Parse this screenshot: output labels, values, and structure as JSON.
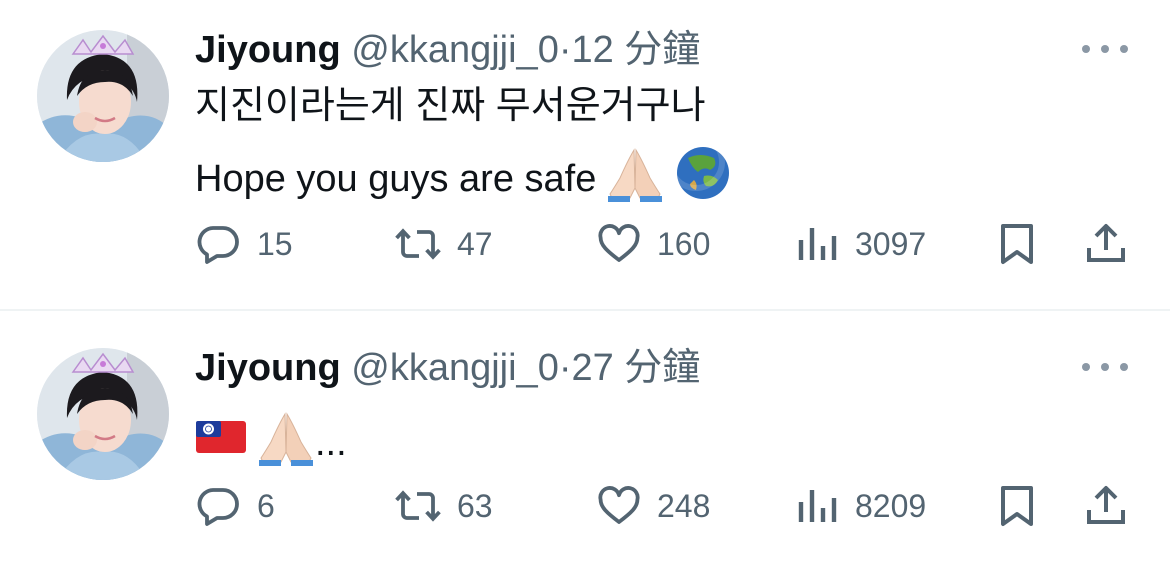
{
  "tweets": [
    {
      "author_name": "Jiyoung",
      "handle": "@kkangjji_0",
      "separator": "·",
      "time": "12 分鐘",
      "text_line_1": "지진이라는게 진짜 무서운거구나",
      "text_line_2": "Hope you guys are safe",
      "emojis": [
        "folded-hands",
        "globe-asia-australia"
      ],
      "stats": {
        "replies": "15",
        "retweets": "47",
        "likes": "160",
        "views": "3097"
      }
    },
    {
      "author_name": "Jiyoung",
      "handle": "@kkangjji_0",
      "separator": "·",
      "time": "27 分鐘",
      "text_suffix": "...",
      "emojis": [
        "flag-taiwan",
        "folded-hands"
      ],
      "stats": {
        "replies": "6",
        "retweets": "63",
        "likes": "248",
        "views": "8209"
      }
    }
  ],
  "icons": {
    "reply": "reply-icon",
    "retweet": "retweet-icon",
    "like": "heart-icon",
    "views": "views-icon",
    "bookmark": "bookmark-icon",
    "share": "share-icon",
    "more": "more-icon"
  },
  "colors": {
    "text": "#0f1419",
    "secondary": "#536471",
    "divider": "#eff3f4"
  }
}
